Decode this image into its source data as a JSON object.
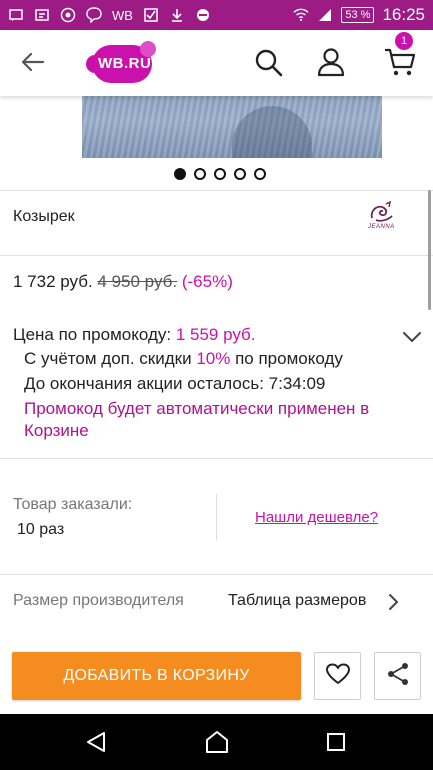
{
  "status_bar": {
    "carrier_icons": [
      "message-icon",
      "cast-icon",
      "chrome-icon",
      "viber-icon"
    ],
    "wb_text": "WB",
    "battery": "53 %",
    "time": "16:25"
  },
  "header": {
    "logo_text": "WB.RU",
    "cart_count": "1"
  },
  "gallery": {
    "total_dots": 5,
    "active_index": 0
  },
  "brand": {
    "name": "Козырек",
    "logo_text": "JEANNA"
  },
  "price": {
    "current": "1 732 руб.",
    "old": "4 950 руб.",
    "discount": "(-65%)"
  },
  "promo": {
    "label": "Цена по промокоду:",
    "price": "1 559 руб.",
    "discount_prefix": "С учётом доп. скидки",
    "discount_pct": "10%",
    "discount_suffix": "по промокоду",
    "timer_label": "До окончания акции осталось: 7:34:09",
    "note": "Промокод будет автоматически применен в Корзине"
  },
  "orders": {
    "label": "Товар заказали:",
    "value": "10 раз",
    "cheaper_link": "Нашли дешевле?"
  },
  "size": {
    "label": "Размер производителя",
    "table_link": "Таблица размеров"
  },
  "actions": {
    "add_to_cart": "ДОБАВИТЬ В КОРЗИНУ"
  },
  "colors": {
    "brand": "#cb11ab",
    "status_bar": "#9c1b85",
    "add_button": "#f58c1f"
  }
}
